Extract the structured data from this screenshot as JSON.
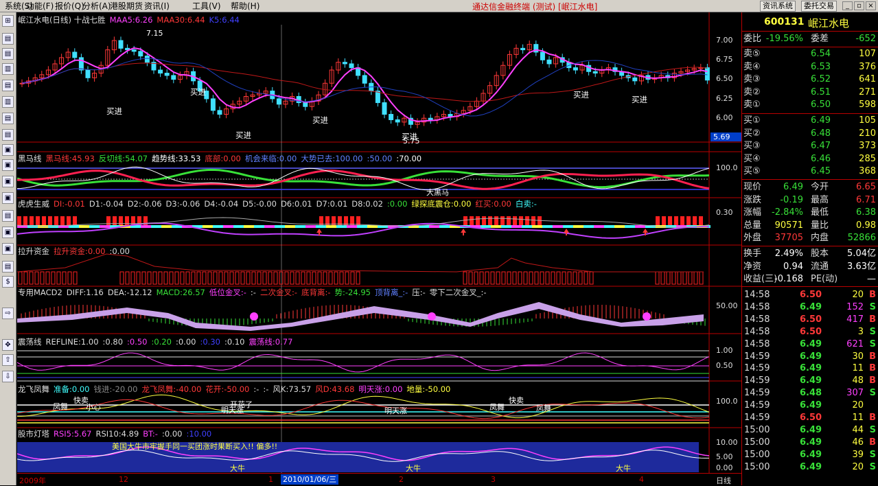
{
  "menu": [
    "系统(S)",
    "功能(F)",
    "报价(Q)",
    "分析(A)",
    "港股期货",
    "资讯(I)",
    "工具(V)",
    "帮助(H)"
  ],
  "brand": "通达信金融终端 (测试) [岷江水电]",
  "top_buttons": [
    "资讯系统",
    "委托交易"
  ],
  "toolbar_icons": [
    "⊞",
    "▤",
    "▤",
    "▥",
    "▤",
    "▥",
    "▤",
    "▤",
    "▣",
    "▣",
    "▣",
    "▣",
    "▤",
    "▣",
    "▣",
    "▤",
    "$",
    "⇨",
    "✥",
    "⇧",
    "⇩"
  ],
  "panels": {
    "main": {
      "name": "岷江水电(日线) 十战七胜",
      "items": [
        {
          "t": "MAA5:6.26",
          "c": "#ff40ff"
        },
        {
          "t": "MAA30:6.44",
          "c": "#ff3838"
        },
        {
          "t": "K5:6.44",
          "c": "#4040ff"
        }
      ],
      "annotations": {
        "high": "7.15",
        "low": "5.75",
        "buy": "买进",
        "cur": "5.69"
      },
      "y_labels": [
        "7.00",
        "6.75",
        "6.50",
        "6.25",
        "6.00"
      ]
    },
    "heima": {
      "name": "黑马线",
      "items": [
        {
          "t": "黑马线:45.93",
          "c": "#ff3838"
        },
        {
          "t": "反切线:54.07",
          "c": "#38e038"
        },
        {
          "t": "趋势线:33.53",
          "c": "#ffffff"
        },
        {
          "t": "底部:0.00",
          "c": "#ff3838"
        },
        {
          "t": "机会来临:0.00",
          "c": "#6080ff"
        },
        {
          "t": "大势已去:100.00",
          "c": "#6080ff"
        },
        {
          "t": ":50.00",
          "c": "#6080ff"
        },
        {
          "t": ":70.00",
          "c": "#ffffff"
        }
      ],
      "y_label": "100.0",
      "tag": "大黑马"
    },
    "huhu": {
      "name": "虎虎生威",
      "items": [
        {
          "t": "DI:-0.01",
          "c": "#ff3838"
        },
        {
          "t": "D1:-0.04",
          "c": "#ddd"
        },
        {
          "t": "D2:-0.06",
          "c": "#ddd"
        },
        {
          "t": "D3:-0.06",
          "c": "#ddd"
        },
        {
          "t": "D4:-0.04",
          "c": "#ddd"
        },
        {
          "t": "D5:-0.00",
          "c": "#ddd"
        },
        {
          "t": "D6:0.01",
          "c": "#ddd"
        },
        {
          "t": "D7:0.01",
          "c": "#ddd"
        },
        {
          "t": "D8:0.02",
          "c": "#ddd"
        },
        {
          "t": ":0.00",
          "c": "#38e038"
        },
        {
          "t": "绿探底震仓:0.00",
          "c": "#ffff40"
        },
        {
          "t": "红买:0.00",
          "c": "#ff3838"
        },
        {
          "t": "白卖:-",
          "c": "#40ffff"
        }
      ],
      "y_label": "0.30"
    },
    "lasheng": {
      "name": "拉升资金",
      "items": [
        {
          "t": "拉升资金:0.00",
          "c": "#ff3838"
        },
        {
          "t": ":0.00",
          "c": "#ddd"
        }
      ]
    },
    "macd": {
      "name": "专用MACD2",
      "items": [
        {
          "t": "DIFF:1.16",
          "c": "#ddd"
        },
        {
          "t": "DEA:-12.12",
          "c": "#ddd"
        },
        {
          "t": "MACD:26.57",
          "c": "#38e038"
        },
        {
          "t": "低位金叉:-",
          "c": "#ff40ff"
        },
        {
          "t": ":-",
          "c": "#ddd"
        },
        {
          "t": "二次金叉:-",
          "c": "#ff3838"
        },
        {
          "t": "底背离:-",
          "c": "#ff3838"
        },
        {
          "t": "势:-24.95",
          "c": "#38e038"
        },
        {
          "t": "顶背离_:-",
          "c": "#6080ff"
        },
        {
          "t": "压:-",
          "c": "#ddd"
        },
        {
          "t": "零下二次金叉_:-",
          "c": "#ddd"
        }
      ],
      "y_label": "50.00"
    },
    "zhendang": {
      "name": "震荡线",
      "items": [
        {
          "t": "REFLINE:1.00",
          "c": "#ddd"
        },
        {
          "t": ":0.80",
          "c": "#ddd"
        },
        {
          "t": ":0.50",
          "c": "#ff40ff"
        },
        {
          "t": ":0.20",
          "c": "#38e038"
        },
        {
          "t": ":0.00",
          "c": "#ddd"
        },
        {
          "t": ":0.30",
          "c": "#4040ff"
        },
        {
          "t": ":0.10",
          "c": "#ddd"
        },
        {
          "t": "震荡线:0.77",
          "c": "#ff40ff"
        }
      ],
      "y_labels": [
        "1.00",
        "0.50"
      ]
    },
    "longfei": {
      "name": "龙飞凤舞",
      "items": [
        {
          "t": "准备:0.00",
          "c": "#40ffff"
        },
        {
          "t": "钱进:-20.00",
          "c": "#888"
        },
        {
          "t": "龙飞凤舞:-40.00",
          "c": "#ff3838"
        },
        {
          "t": "花开:-50.00",
          "c": "#ff3838"
        },
        {
          "t": ":-",
          "c": "#ddd"
        },
        {
          "t": ":-",
          "c": "#ddd"
        },
        {
          "t": "风K:73.57",
          "c": "#ddd"
        },
        {
          "t": "风D:43.68",
          "c": "#ff3838"
        },
        {
          "t": "明天涨:0.00",
          "c": "#ff40ff"
        },
        {
          "t": "地量:-50.00",
          "c": "#ffff40"
        }
      ],
      "y_label": "100.0",
      "tags": [
        "快卖",
        "凤舞",
        "小心",
        "开花了",
        "明天涨",
        "明天涨",
        "快卖",
        "凤舞"
      ]
    },
    "dengta": {
      "name": "股市灯塔",
      "items": [
        {
          "t": "RSI5:5.67",
          "c": "#ff40ff"
        },
        {
          "t": "RSI10:4.89",
          "c": "#ddd"
        },
        {
          "t": "BT:-",
          "c": "#ff40ff"
        },
        {
          "t": ":0.00",
          "c": "#ddd"
        },
        {
          "t": ":10.00",
          "c": "#4040ff"
        }
      ],
      "y_labels": [
        "10.00",
        "5.00",
        "0.00"
      ],
      "msg": "美国大牛市牢握手同一买团涨时果断买入!!  偏多!!",
      "tag": "大牛"
    }
  },
  "bottom_axis": {
    "labels": [
      "2009年",
      "12",
      "1",
      "2",
      "3",
      "4"
    ],
    "date": "2010/01/06/三",
    "period": "日线"
  },
  "quote": {
    "code": "600131",
    "name": "岷江水电",
    "weibi_label": "委比",
    "weibi": "-19.56%",
    "weicha_label": "委差",
    "weicha": "-652",
    "sells": [
      {
        "l": "卖⑤",
        "p": "6.54",
        "v": "107"
      },
      {
        "l": "卖④",
        "p": "6.53",
        "v": "376"
      },
      {
        "l": "卖③",
        "p": "6.52",
        "v": "641"
      },
      {
        "l": "卖②",
        "p": "6.51",
        "v": "271"
      },
      {
        "l": "卖①",
        "p": "6.50",
        "v": "598"
      }
    ],
    "buys": [
      {
        "l": "买①",
        "p": "6.49",
        "v": "105"
      },
      {
        "l": "买②",
        "p": "6.48",
        "v": "210"
      },
      {
        "l": "买③",
        "p": "6.47",
        "v": "373"
      },
      {
        "l": "买④",
        "p": "6.46",
        "v": "285"
      },
      {
        "l": "买⑤",
        "p": "6.45",
        "v": "368"
      }
    ],
    "stats": [
      {
        "l1": "现价",
        "v1": "6.49",
        "c1": "grn",
        "l2": "今开",
        "v2": "6.65",
        "c2": "red"
      },
      {
        "l1": "涨跌",
        "v1": "-0.19",
        "c1": "grn",
        "l2": "最高",
        "v2": "6.71",
        "c2": "red"
      },
      {
        "l1": "涨幅",
        "v1": "-2.84%",
        "c1": "grn",
        "l2": "最低",
        "v2": "6.38",
        "c2": "grn"
      },
      {
        "l1": "总量",
        "v1": "90571",
        "c1": "yel",
        "l2": "量比",
        "v2": "0.98",
        "c2": "yel"
      },
      {
        "l1": "外盘",
        "v1": "37705",
        "c1": "red",
        "l2": "内盘",
        "v2": "52866",
        "c2": "grn"
      }
    ],
    "stats2": [
      {
        "l1": "换手",
        "v1": "2.49%",
        "l2": "股本",
        "v2": "5.04亿"
      },
      {
        "l1": "净资",
        "v1": "0.94",
        "l2": "流通",
        "v2": "3.63亿"
      },
      {
        "l1": "收益(三)",
        "v1": "-0.168",
        "l2": "PE(动)",
        "v2": "—"
      }
    ]
  },
  "ticks": [
    {
      "t": "14:58",
      "p": "6.50",
      "v": "20",
      "s": "B"
    },
    {
      "t": "14:58",
      "p": "6.49",
      "v": "152",
      "s": "S"
    },
    {
      "t": "14:58",
      "p": "6.50",
      "v": "417",
      "s": "B"
    },
    {
      "t": "14:58",
      "p": "6.50",
      "v": "3",
      "s": "S"
    },
    {
      "t": "14:58",
      "p": "6.49",
      "v": "621",
      "s": "S"
    },
    {
      "t": "14:59",
      "p": "6.49",
      "v": "30",
      "s": "B"
    },
    {
      "t": "14:59",
      "p": "6.49",
      "v": "11",
      "s": "B"
    },
    {
      "t": "14:59",
      "p": "6.49",
      "v": "48",
      "s": "B"
    },
    {
      "t": "14:59",
      "p": "6.48",
      "v": "307",
      "s": "S"
    },
    {
      "t": "14:59",
      "p": "6.49",
      "v": "20",
      "s": ""
    },
    {
      "t": "14:59",
      "p": "6.50",
      "v": "11",
      "s": "B"
    },
    {
      "t": "15:00",
      "p": "6.49",
      "v": "44",
      "s": "S"
    },
    {
      "t": "15:00",
      "p": "6.49",
      "v": "46",
      "s": "B"
    },
    {
      "t": "15:00",
      "p": "6.49",
      "v": "39",
      "s": "S"
    },
    {
      "t": "15:00",
      "p": "6.49",
      "v": "20",
      "s": "S"
    }
  ]
}
